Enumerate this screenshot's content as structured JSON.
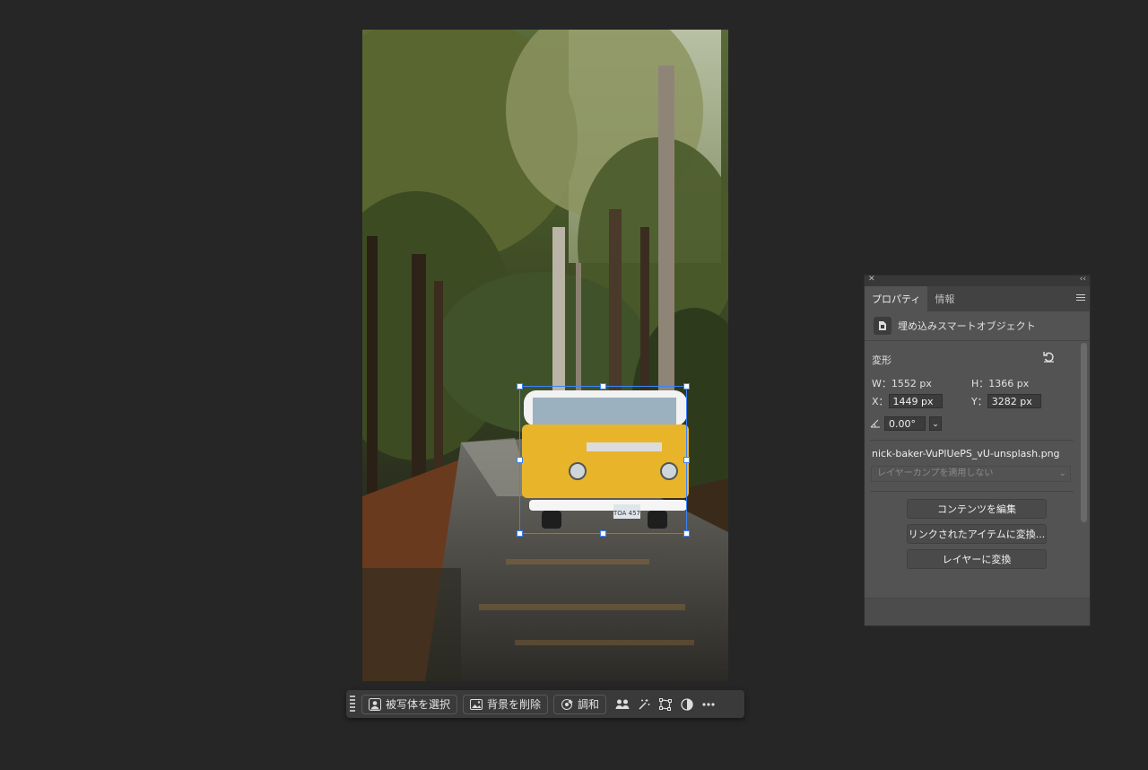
{
  "taskbar": {
    "select_subject": "被写体を選択",
    "remove_background": "背景を削除",
    "harmonize": "調和"
  },
  "panel": {
    "tabs": [
      "プロパティ",
      "情報"
    ],
    "object_type": "埋め込みスマートオブジェクト",
    "transform_label": "変形",
    "w_label": "W：",
    "w_value": "1552 px",
    "h_label": "H：",
    "h_value": "1366 px",
    "x_label": "X：",
    "x_value": "1449 px",
    "y_label": "Y：",
    "y_value": "3282 px",
    "angle_value": "0.00°",
    "filename": "nick-baker-VuPlUePS_vU-unsplash.png",
    "layer_comp_placeholder": "レイヤーカンプを適用しない",
    "edit_contents": "コンテンツを編集",
    "convert_linked": "リンクされたアイテムに変換...",
    "convert_layer": "レイヤーに変換"
  },
  "photo": {
    "plate_text": "TOA 457"
  },
  "colors": {
    "selection": "#3b82f6",
    "van_yellow": "#e8b52a",
    "canvas_bg": "#262626"
  }
}
